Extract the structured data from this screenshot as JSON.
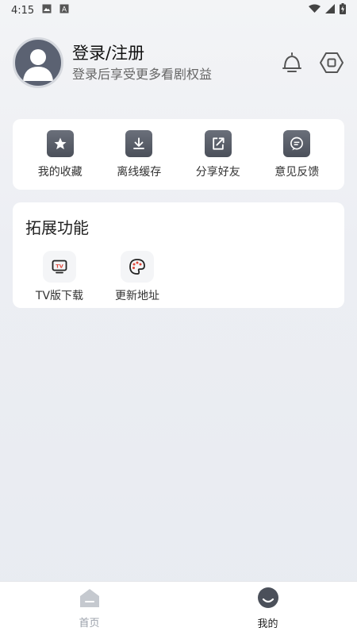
{
  "status_bar": {
    "time": "4:15",
    "left_icons": [
      "image-icon",
      "a-badge-icon"
    ],
    "right_icons": [
      "wifi-icon",
      "signal-icon",
      "battery-charging-icon"
    ]
  },
  "profile": {
    "title": "登录/注册",
    "subtitle": "登录后享受更多看剧权益",
    "avatar_icon": "user-avatar-icon",
    "actions": [
      {
        "name": "notification-bell-icon"
      },
      {
        "name": "settings-hexagon-icon"
      }
    ]
  },
  "quick_actions": [
    {
      "label": "我的收藏",
      "icon": "star-icon"
    },
    {
      "label": "离线缓存",
      "icon": "download-icon"
    },
    {
      "label": "分享好友",
      "icon": "share-icon"
    },
    {
      "label": "意见反馈",
      "icon": "feedback-icon"
    }
  ],
  "extensions": {
    "title": "拓展功能",
    "items": [
      {
        "label": "TV版下载",
        "icon": "tv-icon",
        "icon_text": "TV"
      },
      {
        "label": "更新地址",
        "icon": "palette-icon"
      }
    ]
  },
  "bottom_nav": [
    {
      "label": "首页",
      "icon": "home-icon",
      "active": false
    },
    {
      "label": "我的",
      "icon": "profile-face-icon",
      "active": true
    }
  ],
  "colors": {
    "accent_dark": "#4b505a",
    "tv_red": "#e0483a",
    "nav_inactive": "#9aa0aa"
  }
}
